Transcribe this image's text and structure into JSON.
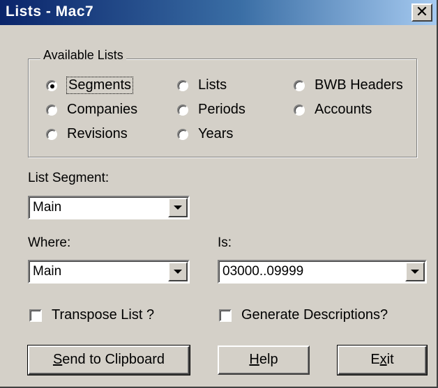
{
  "window": {
    "title": "Lists - Mac7",
    "close_glyph": "✕"
  },
  "available_lists": {
    "legend": "Available Lists",
    "options": [
      {
        "label": "Segments",
        "checked": true
      },
      {
        "label": "Lists",
        "checked": false
      },
      {
        "label": "BWB Headers",
        "checked": false
      },
      {
        "label": "Companies",
        "checked": false
      },
      {
        "label": "Periods",
        "checked": false
      },
      {
        "label": "Accounts",
        "checked": false
      },
      {
        "label": "Revisions",
        "checked": false
      },
      {
        "label": "Years",
        "checked": false
      }
    ]
  },
  "list_segment": {
    "label": "List Segment:",
    "value": "Main"
  },
  "where": {
    "label": "Where:",
    "value": "Main"
  },
  "is": {
    "label": "Is:",
    "value": "03000..09999"
  },
  "options": {
    "transpose_label": "Transpose List ?",
    "transpose_checked": false,
    "generate_label": "Generate Descriptions?",
    "generate_checked": false
  },
  "buttons": {
    "send_mnemonic": "S",
    "send_rest": "end to Clipboard",
    "help_mnemonic": "H",
    "help_rest": "elp",
    "exit_pre": "E",
    "exit_mnemonic": "x",
    "exit_post": "it"
  }
}
